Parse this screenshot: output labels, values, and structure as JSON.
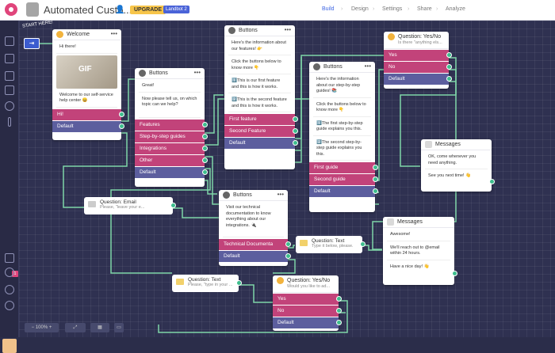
{
  "app": {
    "title": "Automated Custo...",
    "upgrade_label": "UPGRADE",
    "badge": "Landbot 2"
  },
  "nav": {
    "items": [
      "Build",
      "Design",
      "Settings",
      "Share",
      "Analyze"
    ],
    "active": "Build"
  },
  "start": {
    "label": "START HERE!"
  },
  "welcome": {
    "title": "Welcome",
    "messages": [
      "Hi there!",
      "Welcome to our self-service help center 😄"
    ],
    "gif": "GIF",
    "buttons": [
      "Hi!",
      "Default"
    ]
  },
  "buttons1": {
    "title": "Buttons",
    "messages": [
      "Great!",
      "Now please tell us, on which topic can we help?"
    ],
    "buttons": [
      "Features",
      "Step-by-step guides",
      "Integrations",
      "Other",
      "Default"
    ]
  },
  "buttons2": {
    "title": "Buttons",
    "messages": [
      "Here's the information about our features! 👉",
      "Click the buttons below to know more 👇",
      "1️⃣This is our first feature and this is how it works.",
      "2️⃣This is the second feature and this is how it works."
    ],
    "buttons": [
      "First feature",
      "Second Feature",
      "Default"
    ]
  },
  "buttons3": {
    "title": "Buttons",
    "messages": [
      "Here's the information about our step-by-step guides! 📚",
      "Click the buttons below to know more 👇",
      "1️⃣The first step-by-step guide explains you this.",
      "2️⃣The second step-by-step guide explains you this."
    ],
    "buttons": [
      "First guide",
      "Second guide",
      "Default"
    ]
  },
  "yesno1": {
    "title": "Question: Yes/No",
    "subtitle": "Is there \"anything els...",
    "buttons": [
      "Yes",
      "No",
      "Default"
    ]
  },
  "messages1": {
    "title": "Messages",
    "messages": [
      "OK, come whenever you need anything.",
      "See you next time! 👋"
    ]
  },
  "email": {
    "title": "Question: Email",
    "subtitle": "Please, \"leave your e..."
  },
  "buttons4": {
    "title": "Buttons",
    "messages": [
      "Visit our technical documentation to know everything about our integrations. 🔌"
    ],
    "buttons": [
      "Technical Documenta",
      "Default"
    ]
  },
  "text1": {
    "title": "Question: Text",
    "subtitle": "Type it below, please."
  },
  "messages2": {
    "title": "Messages",
    "messages": [
      "Awesome!",
      "We'll reach out to @email within 24 hours.",
      "Have a nice day! 👋"
    ]
  },
  "text2": {
    "title": "Question: Text",
    "subtitle": "Please, \"type in your ..."
  },
  "yesno2": {
    "title": "Question: Yes/No",
    "subtitle": "Would you like to ad...",
    "buttons": [
      "Yes",
      "No",
      "Default"
    ]
  },
  "zoom": {
    "level": "100%"
  },
  "sidebar": {
    "badge": "1"
  },
  "colors": {
    "pink": "#c2437a",
    "gray": "#5c5e9e",
    "green": "#3dbd8d",
    "canvas": "#2f3151"
  }
}
